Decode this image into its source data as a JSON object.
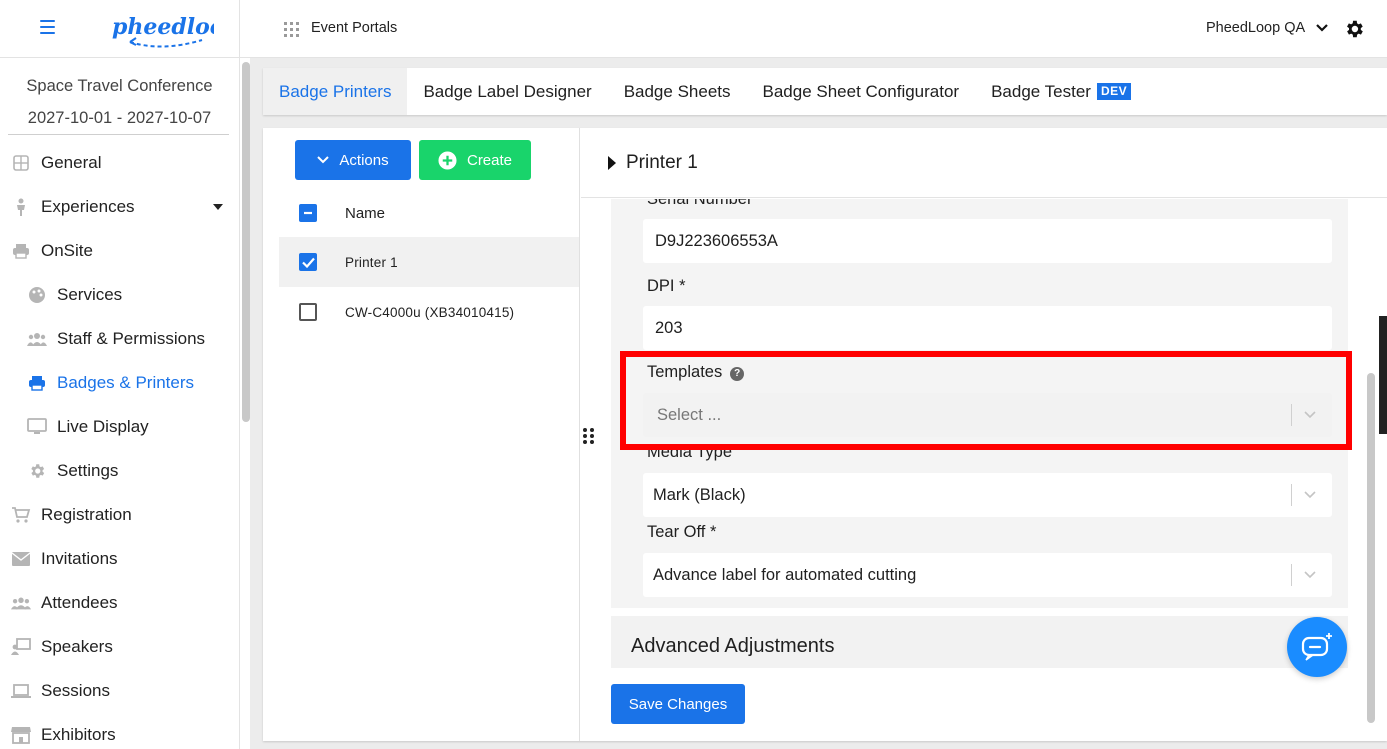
{
  "brand": {
    "logo_text": "pheedloop",
    "accent": "#1a73e8"
  },
  "event": {
    "name": "Space Travel Conference",
    "dates": "2027-10-01 - 2027-10-07"
  },
  "sidebar": {
    "items": [
      {
        "label": "General",
        "icon": "grid-icon"
      },
      {
        "label": "Experiences",
        "icon": "person-icon",
        "expandable": true
      },
      {
        "label": "OnSite",
        "icon": "printer-icon"
      },
      {
        "label": "Services",
        "icon": "palette-icon",
        "sub": true
      },
      {
        "label": "Staff & Permissions",
        "icon": "group-icon",
        "sub": true
      },
      {
        "label": "Badges & Printers",
        "icon": "printer-icon",
        "sub": true,
        "active": true
      },
      {
        "label": "Live Display",
        "icon": "monitor-icon",
        "sub": true
      },
      {
        "label": "Settings",
        "icon": "gear-icon",
        "sub": true
      },
      {
        "label": "Registration",
        "icon": "cart-icon"
      },
      {
        "label": "Invitations",
        "icon": "mail-icon"
      },
      {
        "label": "Attendees",
        "icon": "people-icon"
      },
      {
        "label": "Speakers",
        "icon": "presenter-icon"
      },
      {
        "label": "Sessions",
        "icon": "laptop-icon"
      },
      {
        "label": "Exhibitors",
        "icon": "storefront-icon"
      }
    ]
  },
  "topbar": {
    "portal_label": "Event Portals",
    "account": "PheedLoop QA"
  },
  "tabs": [
    {
      "label": "Badge Printers",
      "active": true
    },
    {
      "label": "Badge Label Designer"
    },
    {
      "label": "Badge Sheets"
    },
    {
      "label": "Badge Sheet Configurator"
    },
    {
      "label": "Badge Tester",
      "badge": "DEV"
    }
  ],
  "list": {
    "actions_label": "Actions",
    "create_label": "Create",
    "column_header": "Name",
    "rows": [
      {
        "name": "Printer 1",
        "checked": true
      },
      {
        "name": "CW-C4000u (XB34010415)",
        "checked": false
      }
    ]
  },
  "detail": {
    "title": "Printer 1",
    "serial_label": "Serial Number",
    "serial_value": "D9J223606553A",
    "dpi_label": "DPI *",
    "dpi_value": "203",
    "templates_label": "Templates",
    "templates_placeholder": "Select ...",
    "media_label": "Media Type",
    "media_value": "Mark (Black)",
    "tearoff_label": "Tear Off *",
    "tearoff_value": "Advance label for automated cutting",
    "advanced_label": "Advanced Adjustments",
    "save_label": "Save Changes"
  },
  "colors": {
    "primary": "#1a73e8",
    "create": "#19d46b",
    "highlight": "#ff0000",
    "chat": "#1a8cff"
  }
}
